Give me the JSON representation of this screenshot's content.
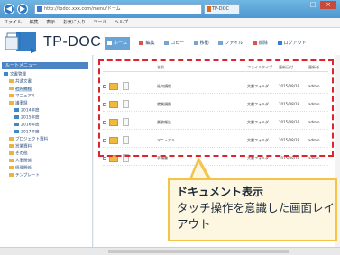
{
  "browser": {
    "address": "http://tpdoc.xxx.com/menu/ドーム",
    "tab_label": "TP-DOC",
    "back_glyph": "◀",
    "forward_glyph": "▶",
    "minimize": "–",
    "maximize": "□",
    "close": "×"
  },
  "menubar": {
    "items": [
      "ファイル",
      "編集",
      "表示",
      "お気に入り",
      "ツール",
      "ヘルプ"
    ]
  },
  "app": {
    "logo_text": "TP-DOC",
    "logo_color": "#1f6fbf",
    "toolbar": [
      {
        "label": "ホーム",
        "active": true,
        "icon": "home-icon"
      },
      {
        "label": "編集",
        "active": false,
        "icon": "edit-icon"
      },
      {
        "label": "コピー",
        "active": false,
        "icon": "copy-icon"
      },
      {
        "label": "移動",
        "active": false,
        "icon": "move-icon"
      },
      {
        "label": "ファイル",
        "active": false,
        "icon": "file-icon"
      },
      {
        "label": "削除",
        "active": false,
        "icon": "delete-icon"
      },
      {
        "label": "ログアウト",
        "active": false,
        "icon": "logout-icon"
      }
    ]
  },
  "left_panel": {
    "header": "ルートメニュー",
    "tree": [
      {
        "label": "文書管理",
        "indent": 0,
        "selected": false
      },
      {
        "label": "共通文書",
        "indent": 1,
        "selected": false
      },
      {
        "label": "社内規程",
        "indent": 1,
        "selected": true
      },
      {
        "label": "マニュアル",
        "indent": 1,
        "selected": false
      },
      {
        "label": "議事録",
        "indent": 1,
        "selected": false
      },
      {
        "label": "2014年度",
        "indent": 2,
        "selected": false
      },
      {
        "label": "2015年度",
        "indent": 2,
        "selected": false
      },
      {
        "label": "2016年度",
        "indent": 2,
        "selected": false
      },
      {
        "label": "2017年度",
        "indent": 2,
        "selected": false
      },
      {
        "label": "プロジェクト資料",
        "indent": 1,
        "selected": false
      },
      {
        "label": "営業資料",
        "indent": 1,
        "selected": false
      },
      {
        "label": "その他",
        "indent": 1,
        "selected": false
      },
      {
        "label": "人事関係",
        "indent": 1,
        "selected": false
      },
      {
        "label": "経理関係",
        "indent": 1,
        "selected": false
      },
      {
        "label": "テンプレート",
        "indent": 1,
        "selected": false
      }
    ]
  },
  "table": {
    "headers": [
      "名前",
      "ファイルタイプ",
      "更新日付",
      "更新者"
    ],
    "rows": [
      {
        "name": "社内規程",
        "type": "文書フォルダ",
        "date": "2015/08/18",
        "user": "admin"
      },
      {
        "name": "就業規則",
        "type": "文書フォルダ",
        "date": "2015/08/18",
        "user": "admin"
      },
      {
        "name": "業務報告",
        "type": "文書フォルダ",
        "date": "2015/08/18",
        "user": "admin"
      },
      {
        "name": "マニュアル",
        "type": "文書フォルダ",
        "date": "2015/08/18",
        "user": "admin"
      },
      {
        "name": "手順書",
        "type": "文書フォルダ",
        "date": "2015/08/18",
        "user": "admin"
      }
    ]
  },
  "callout": {
    "title": "ドキュメント表示",
    "body": "タッチ操作を意識した画面レイアウト"
  },
  "colors": {
    "highlight": "#e0222f",
    "callout_border": "#f5c24a",
    "callout_fill": "#fdf6e0",
    "titlebar": "#4f97cf"
  }
}
